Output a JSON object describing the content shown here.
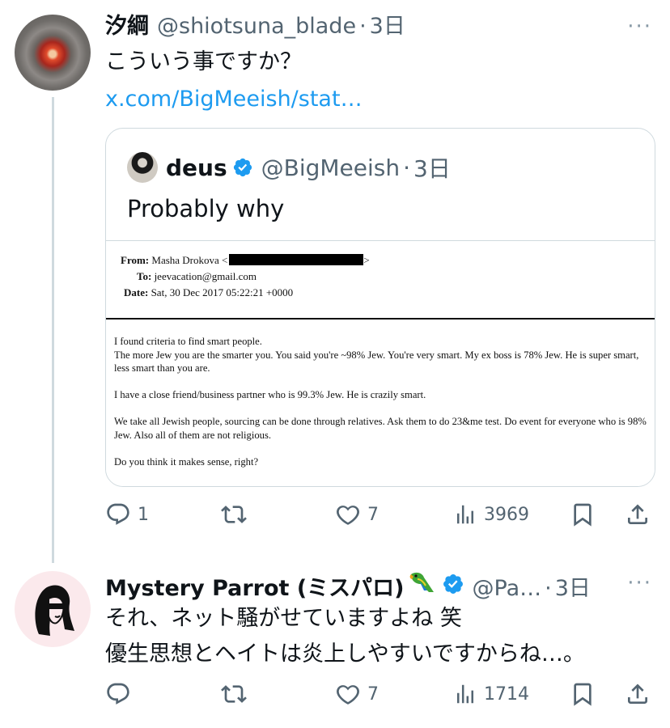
{
  "tweets": [
    {
      "name": "汐綱",
      "handle": "@shiotsuna_blade",
      "dot": "·",
      "time": "3日",
      "text": "こういう事ですか？",
      "link": "x.com/BigMeeish/stat…",
      "quoted": {
        "name": "deus",
        "handle": "@BigMeeish",
        "dot": "·",
        "time": "3日",
        "text": "Probably why",
        "email": {
          "from_label": "From:",
          "from_value": "Masha Drokova <",
          "from_end": ">",
          "to_label": "To:",
          "to_value": "jeevacation@gmail.com",
          "date_label": "Date:",
          "date_value": "Sat, 30 Dec 2017 05:22:21 +0000",
          "paragraphs": [
            "I found criteria to find smart people.\nThe more Jew you are the smarter you. You said you're ~98% Jew. You're very smart. My ex boss is 78% Jew. He is super smart, less smart than you are.",
            "I have a close friend/business partner who is 99.3% Jew. He is crazily smart.",
            "We take all Jewish people, sourcing can be done through relatives. Ask them to do 23&me test. Do event for everyone who is 98% Jew. Also all of them are not religious.",
            "Do you think it makes sense, right?"
          ]
        }
      },
      "stats": {
        "replies": "1",
        "reposts": "",
        "likes": "7",
        "views": "3969"
      }
    },
    {
      "name": "Mystery Parrot (ミスパロ)",
      "handle": "@Pa…",
      "dot": "·",
      "time": "3日",
      "text_line1": "それ、ネット騒がせていますよね 笑",
      "text_line2": "優生思想とヘイトは炎上しやすいですからね…。",
      "stats": {
        "replies": "",
        "reposts": "",
        "likes": "7",
        "views": "1714"
      }
    }
  ],
  "more_label": "···",
  "colors": {
    "accent": "#1d9bf0",
    "muted": "#536471",
    "border": "#cfd9de",
    "text": "#0f1419"
  },
  "icons": [
    "more-icon",
    "verified-badge-icon",
    "parrot-emoji-icon",
    "reply-icon",
    "repost-icon",
    "like-icon",
    "views-icon",
    "bookmark-icon",
    "share-icon"
  ]
}
